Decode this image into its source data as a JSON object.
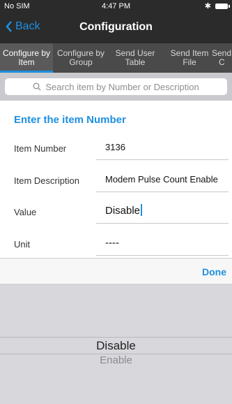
{
  "status_bar": {
    "carrier": "No SIM",
    "time": "4:47 PM",
    "bluetooth_icon": "bluetooth-icon",
    "battery_icon": "battery-icon"
  },
  "nav": {
    "back_label": "Back",
    "title": "Configuration",
    "accent_color": "#1e8fe0"
  },
  "tabs": [
    {
      "line1": "Configure by",
      "line2": "Item",
      "active": true
    },
    {
      "line1": "Configure by",
      "line2": "Group",
      "active": false
    },
    {
      "line1": "Send User",
      "line2": "Table",
      "active": false
    },
    {
      "line1": "Send Item",
      "line2": "File",
      "active": false
    },
    {
      "line1": "Send",
      "line2": "C",
      "active": false
    }
  ],
  "search": {
    "placeholder": "Search item by Number or Description"
  },
  "form": {
    "section_title": "Enter the item Number",
    "fields": [
      {
        "label": "Item Number",
        "value": "3136"
      },
      {
        "label": "Item Description",
        "value": "Modem Pulse Count Enable"
      },
      {
        "label": "Value",
        "value": "Disable"
      },
      {
        "label": "Unit",
        "value": "----"
      }
    ]
  },
  "toolbar": {
    "done_label": "Done"
  },
  "picker": {
    "selected": "Disable",
    "options": [
      "Disable",
      "Enable"
    ]
  }
}
